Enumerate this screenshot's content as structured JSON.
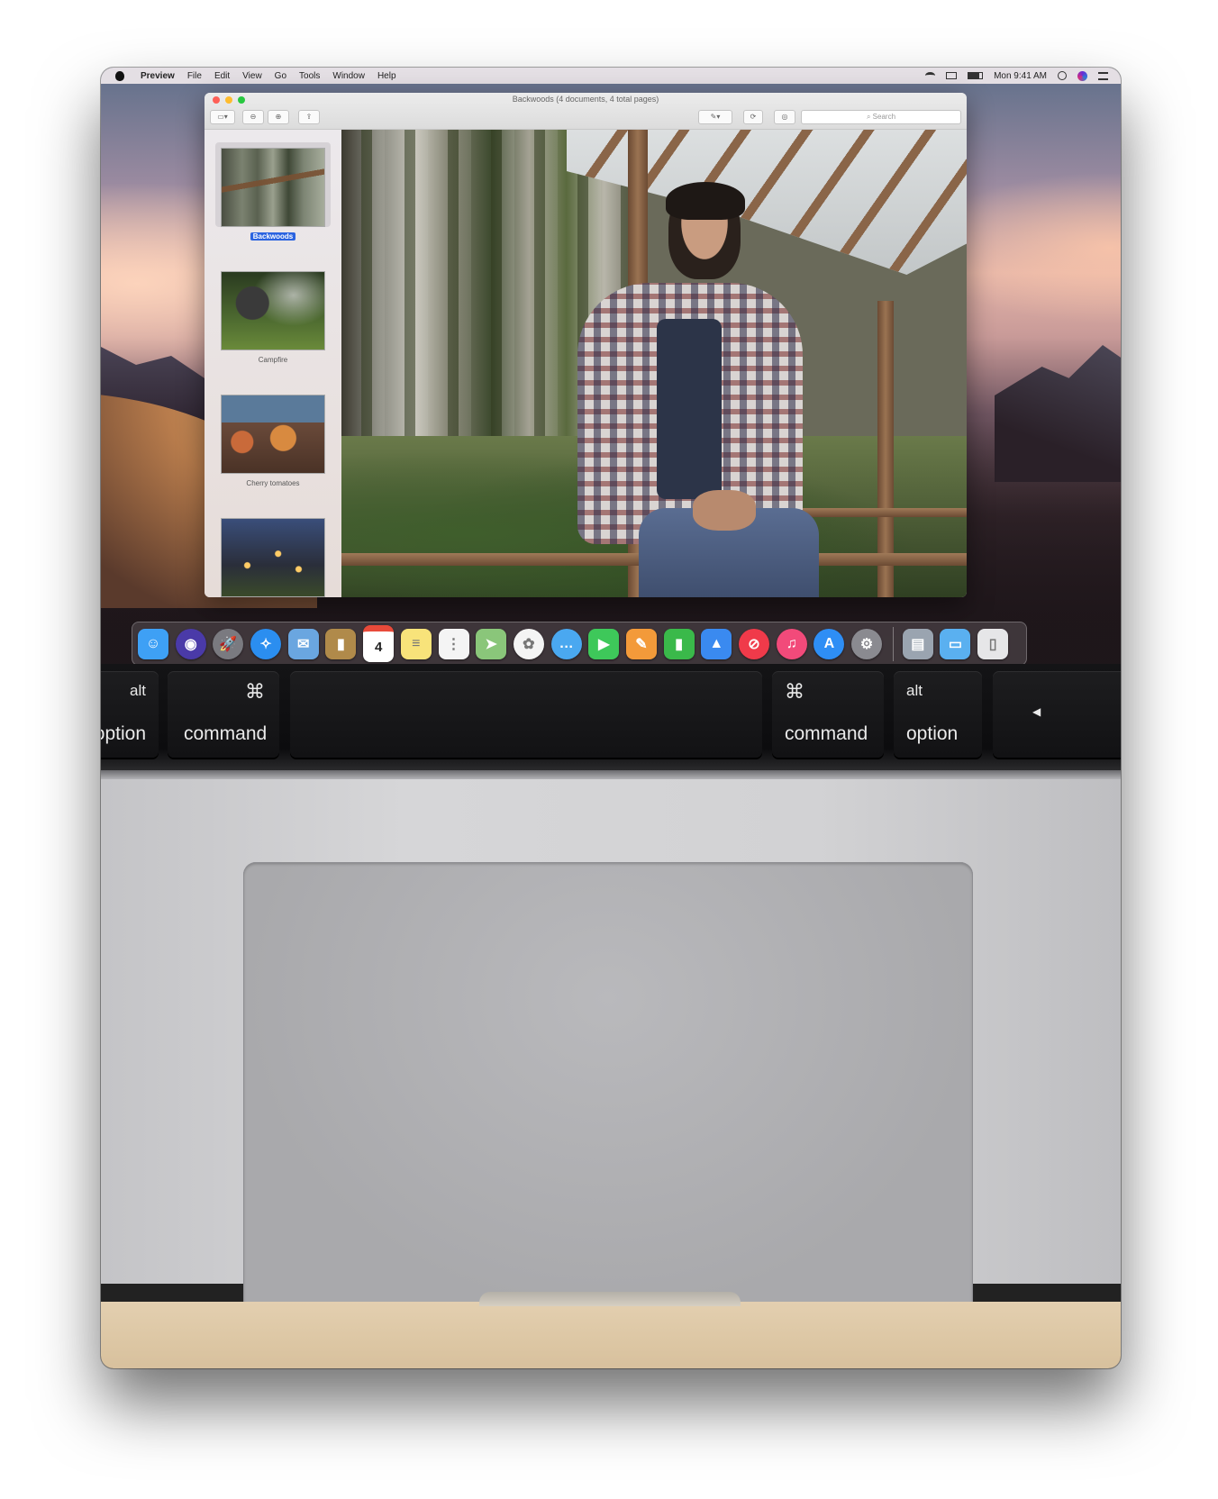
{
  "menubar": {
    "app_name": "Preview",
    "items": [
      "File",
      "Edit",
      "View",
      "Go",
      "Tools",
      "Window",
      "Help"
    ],
    "clock": "Mon 9:41 AM"
  },
  "window": {
    "title": "Backwoods (4 documents, 4 total pages)",
    "search_placeholder": "Search",
    "sidebar": [
      {
        "caption": "Backwoods",
        "selected": true
      },
      {
        "caption": "Campfire",
        "selected": false
      },
      {
        "caption": "Cherry tomatoes",
        "selected": false
      },
      {
        "caption": "",
        "selected": false
      }
    ]
  },
  "dock": {
    "apps": [
      {
        "name": "finder-icon",
        "color": "#3ea0f5"
      },
      {
        "name": "siri-icon",
        "color": "#4a3aa8"
      },
      {
        "name": "launchpad-icon",
        "color": "#7a7a80"
      },
      {
        "name": "safari-icon",
        "color": "#2b8ef0"
      },
      {
        "name": "mail-icon",
        "color": "#6aa6e0"
      },
      {
        "name": "contacts-icon",
        "color": "#b08a4a"
      },
      {
        "name": "calendar-icon",
        "color": "#ffffff"
      },
      {
        "name": "notes-icon",
        "color": "#f8e37a"
      },
      {
        "name": "reminders-icon",
        "color": "#f4f4f4"
      },
      {
        "name": "maps-icon",
        "color": "#8ac67a"
      },
      {
        "name": "photos-icon",
        "color": "#f4f4f4"
      },
      {
        "name": "messages-icon",
        "color": "#4aa8f0"
      },
      {
        "name": "facetime-icon",
        "color": "#3ec85a"
      },
      {
        "name": "pages-icon",
        "color": "#f39a3a"
      },
      {
        "name": "numbers-icon",
        "color": "#3ab94a"
      },
      {
        "name": "keynote-icon",
        "color": "#3a8af0"
      },
      {
        "name": "news-icon",
        "color": "#f03a4a"
      },
      {
        "name": "music-icon",
        "color": "#f24a7a"
      },
      {
        "name": "app-store-icon",
        "color": "#2e8ef5"
      },
      {
        "name": "system-preferences-icon",
        "color": "#8a8a90"
      }
    ],
    "tray": [
      {
        "name": "preview-icon",
        "color": "#9aa4b0"
      },
      {
        "name": "downloads-folder-icon",
        "color": "#5ab0f0"
      },
      {
        "name": "trash-icon",
        "color": "#e6e6e8"
      }
    ],
    "calendar_day": "4"
  },
  "keyboard": {
    "keys": [
      {
        "id": "left-option",
        "top": "alt",
        "bottom": "option"
      },
      {
        "id": "left-command",
        "top": "⌘",
        "bottom": "command"
      },
      {
        "id": "space",
        "top": "",
        "bottom": ""
      },
      {
        "id": "right-command",
        "top": "⌘",
        "bottom": "command"
      },
      {
        "id": "right-option",
        "top": "alt",
        "bottom": "option"
      },
      {
        "id": "left-arrow",
        "top": "◀",
        "bottom": ""
      }
    ]
  }
}
